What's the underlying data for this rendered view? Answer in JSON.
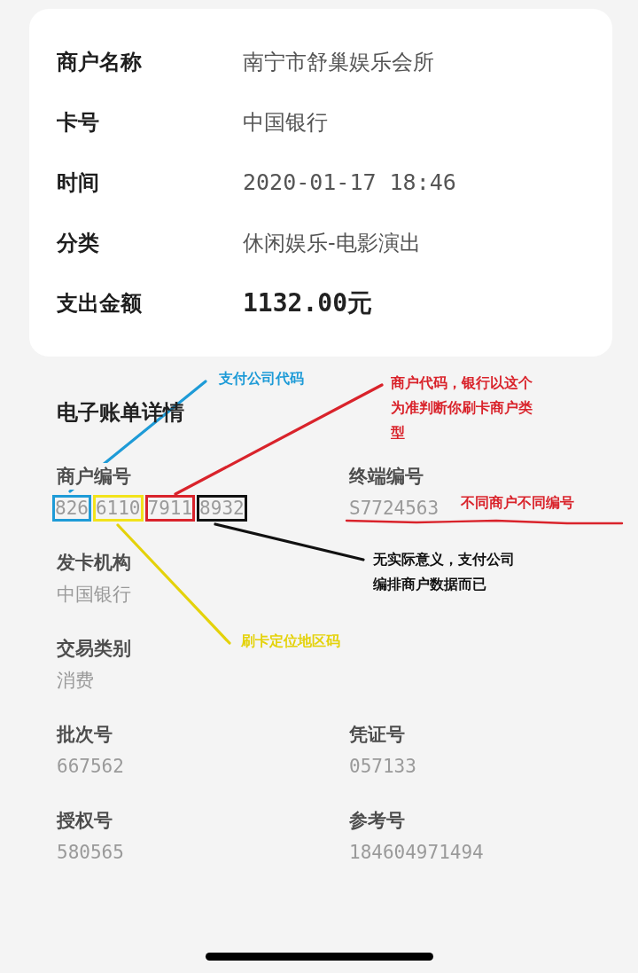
{
  "summary_card": {
    "rows": [
      {
        "label": "商户名称",
        "value": "南宁市舒巢娱乐会所",
        "kind": "plain"
      },
      {
        "label": "卡号",
        "value": "中国银行",
        "kind": "plain"
      },
      {
        "label": "时间",
        "value": "2020-01-17 18:46",
        "kind": "numeric"
      },
      {
        "label": "分类",
        "value": "休闲娱乐-电影演出",
        "kind": "plain"
      },
      {
        "label": "支出金额",
        "value": "1132.00元",
        "kind": "amount"
      }
    ]
  },
  "details": {
    "title": "电子账单详情",
    "rows": [
      [
        {
          "label": "商户编号",
          "segments": [
            {
              "text": "826",
              "color": "#1e9bd7"
            },
            {
              "text": "6110",
              "color": "#f2e31b"
            },
            {
              "text": "7911",
              "color": "#d9232b"
            },
            {
              "text": "8932",
              "color": "#111111"
            }
          ]
        },
        {
          "label": "终端编号",
          "value": "S7724563"
        }
      ],
      [
        {
          "label": "发卡机构",
          "value": "中国银行"
        }
      ],
      [
        {
          "label": "交易类别",
          "value": "消费"
        }
      ],
      [
        {
          "label": "批次号",
          "value": "667562"
        },
        {
          "label": "凭证号",
          "value": "057133"
        }
      ],
      [
        {
          "label": "授权号",
          "value": "580565"
        },
        {
          "label": "参考号",
          "value": "184604971494"
        }
      ]
    ]
  },
  "annotations": [
    {
      "kind": "leader",
      "text": "支付公司代码",
      "color": "#1e9bd7"
    },
    {
      "kind": "leader",
      "text": "商户代码，银行以这个为准判断你刷卡商户类型",
      "color": "#d9232b"
    },
    {
      "kind": "underline",
      "text": "不同商户不同编号",
      "color": "#d9232b"
    },
    {
      "kind": "leader",
      "text": "无实际意义，支付公司编排商户数据而已",
      "color": "#111111"
    },
    {
      "kind": "leader",
      "text": "刷卡定位地区码",
      "color": "#e4d20a"
    }
  ]
}
